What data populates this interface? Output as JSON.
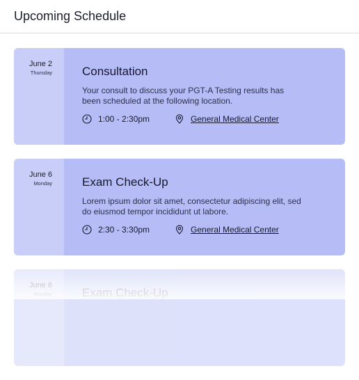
{
  "header": {
    "title": "Upcoming Schedule"
  },
  "appointments": [
    {
      "day": "June 2",
      "weekday": "Thursday",
      "title": "Consultation",
      "description": "Your consult to discuss your PGT-A Testing results has been scheduled at the following location.",
      "time": "1:00 - 2:30pm",
      "location": "General Medical Center"
    },
    {
      "day": "June 6",
      "weekday": "Monday",
      "title": "Exam Check-Up",
      "description": "Lorem ipsum dolor sit amet, consectetur adipiscing elit, sed do eiusmod tempor incididunt ut labore.",
      "time": "2:30 - 3:30pm",
      "location": "General Medical Center"
    },
    {
      "day": "June 6",
      "weekday": "Monday",
      "title": "Exam Check-Up"
    }
  ],
  "icons": {
    "time": "clock-icon",
    "location": "map-pin-icon"
  },
  "colors": {
    "card_bg": "#b6bdf6",
    "date_bg": "#c9cef8"
  }
}
